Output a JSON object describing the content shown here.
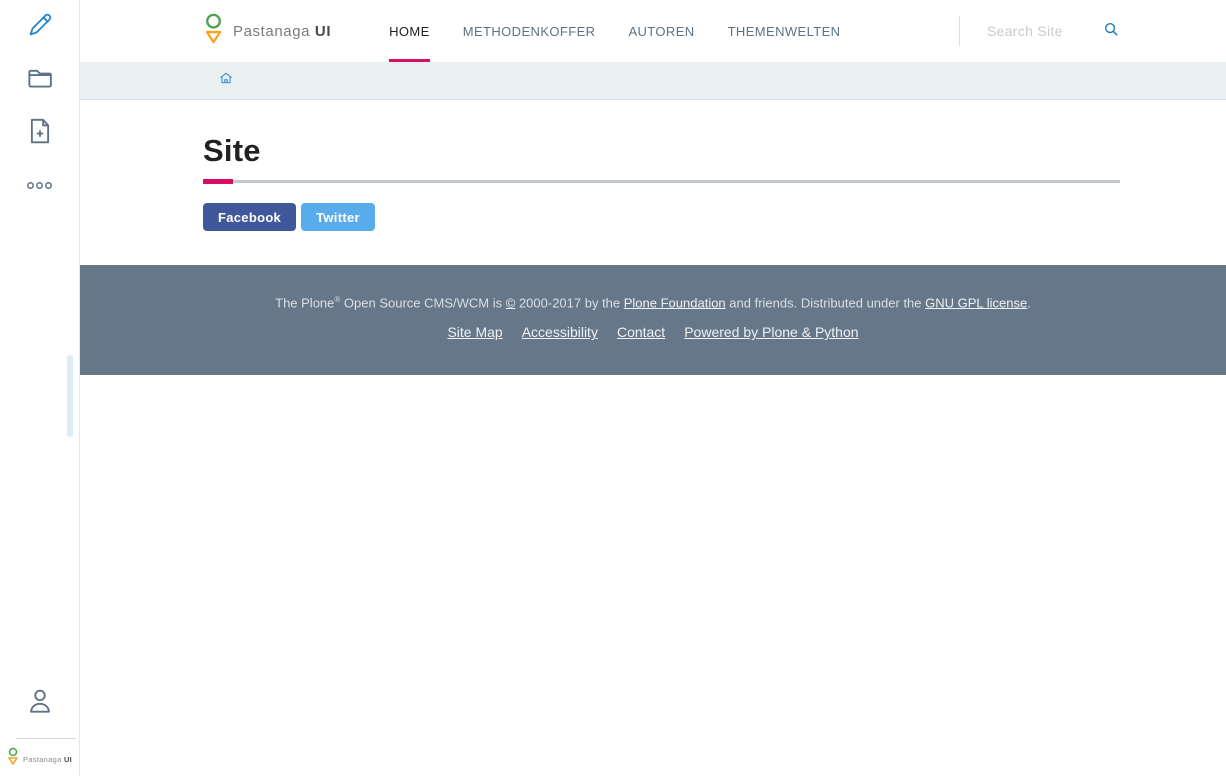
{
  "brand": {
    "name": "Pastanaga",
    "suffix": "UI"
  },
  "icons": {
    "edit": "edit-pencil-icon",
    "contents": "folder-icon",
    "add": "add-document-icon",
    "more": "more-options-icon",
    "user": "user-icon",
    "search": "search-icon",
    "home": "home-icon",
    "logo": "pastanaga-logo-icon"
  },
  "nav": {
    "items": [
      {
        "label": "HOME",
        "active": true
      },
      {
        "label": "METHODENKOFFER",
        "active": false
      },
      {
        "label": "AUTOREN",
        "active": false
      },
      {
        "label": "THEMENWELTEN",
        "active": false
      }
    ]
  },
  "search": {
    "placeholder": "Search Site"
  },
  "page": {
    "title": "Site"
  },
  "share": {
    "facebook": "Facebook",
    "twitter": "Twitter"
  },
  "footer": {
    "text_pre": "The Plone",
    "reg_mark": "®",
    "text_a": " Open Source CMS/WCM is ",
    "copyright_symbol": "©",
    "text_b": " 2000-2017 by the ",
    "foundation_link": "Plone Foundation",
    "text_c": " and friends. Distributed under the ",
    "license_link": "GNU GPL license",
    "text_d": ".",
    "links": [
      "Site Map",
      "Accessibility",
      "Contact",
      "Powered by Plone & Python"
    ]
  },
  "colors": {
    "accent_pink": "#d80e65",
    "toolbar_icon_blue": "#2389cb",
    "icon_slate": "#5e7186",
    "logo_green": "#4ba24e",
    "logo_orange": "#f7a31b",
    "facebook_blue": "#41579c",
    "twitter_blue": "#58aceb",
    "footer_slate": "#66778a",
    "breadcrumb_bg": "#eaeff1"
  }
}
